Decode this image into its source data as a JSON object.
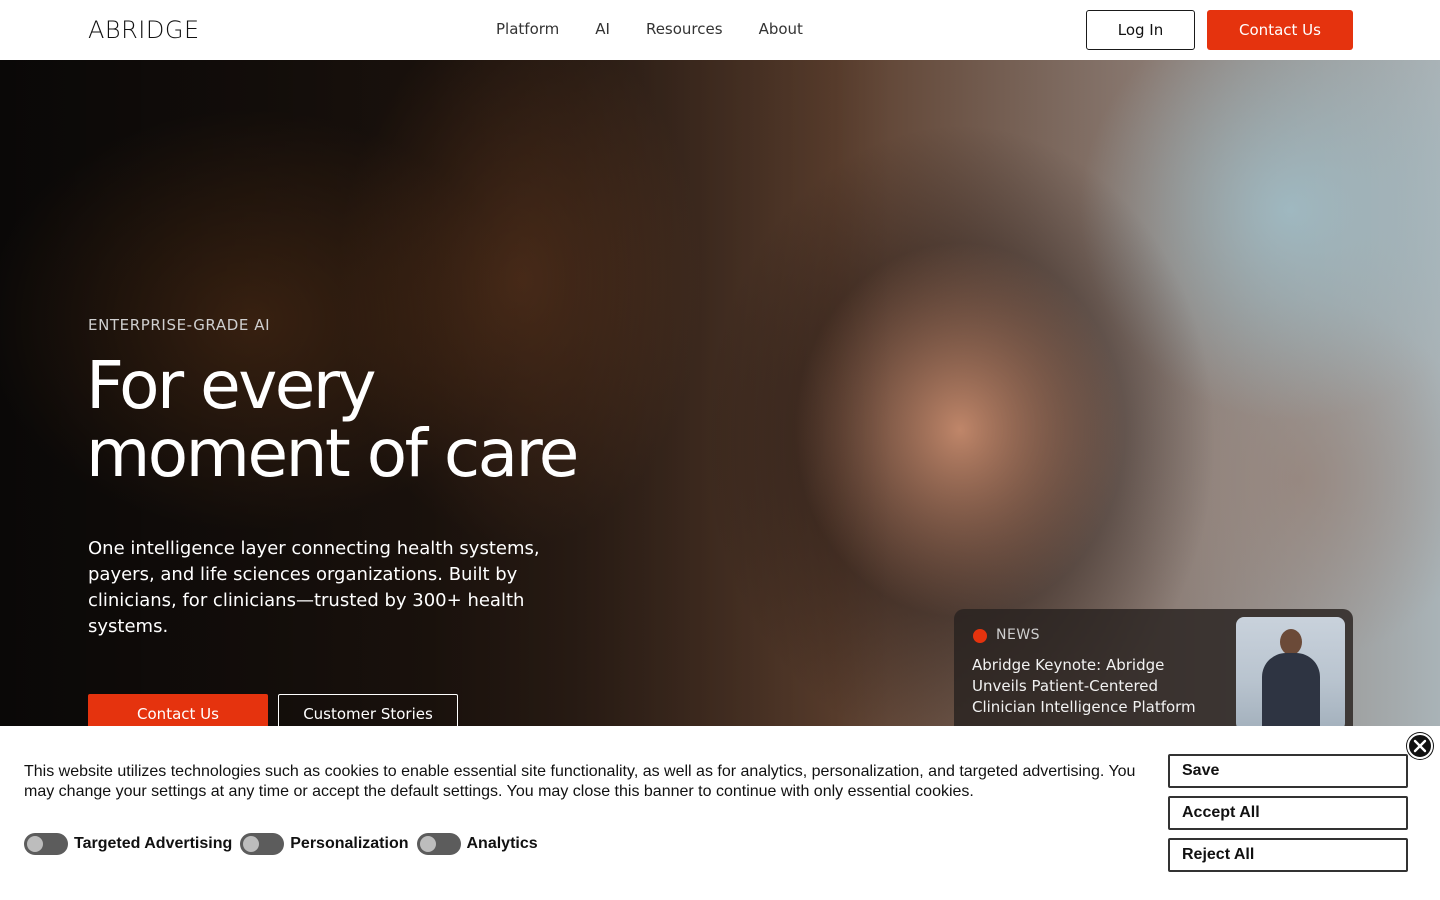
{
  "nav": {
    "logo": "ABRIDGE",
    "links": [
      "Platform",
      "AI",
      "Resources",
      "About"
    ],
    "login_label": "Log In",
    "contact_label": "Contact Us"
  },
  "hero": {
    "eyebrow": "ENTERPRISE-GRADE AI",
    "headline_line1": "For every",
    "headline_line2": "moment of care",
    "description": "One intelligence layer connecting health systems, payers, and life sciences organizations. Built by clinicians, for clinicians—trusted by 300+ health systems.",
    "contact_label": "Contact Us",
    "stories_label": "Customer Stories"
  },
  "news": {
    "label": "NEWS",
    "title": "Abridge Keynote: Abridge Unveils Patient-Centered Clinician Intelligence Platform"
  },
  "cookie_banner": {
    "text": "This website utilizes technologies such as cookies to enable essential site functionality, as well as for analytics, personalization, and targeted advertising. You may change your settings at any time or accept the default settings. You may close this banner to continue with only essential cookies.",
    "toggles": [
      {
        "label": "Targeted Advertising",
        "enabled": false
      },
      {
        "label": "Personalization",
        "enabled": false
      },
      {
        "label": "Analytics",
        "enabled": false
      }
    ],
    "save_label": "Save",
    "accept_label": "Accept All",
    "reject_label": "Reject All"
  },
  "colors": {
    "accent": "#e5330e",
    "text_dark": "#111111",
    "toggle_off": "#5c5c5c"
  }
}
